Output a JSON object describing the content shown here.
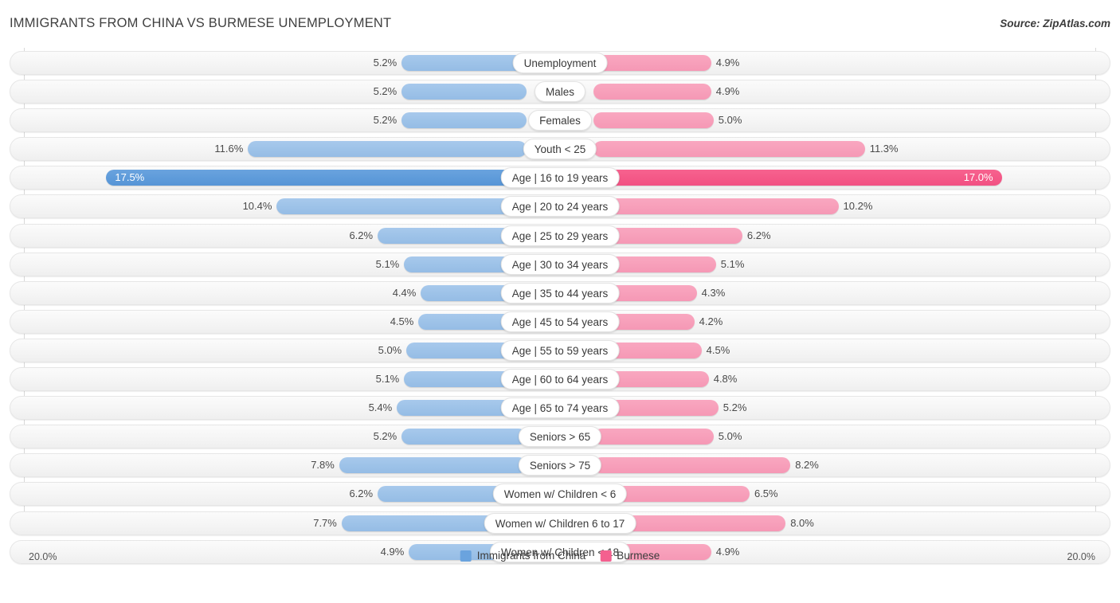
{
  "header": {
    "title": "IMMIGRANTS FROM CHINA VS BURMESE UNEMPLOYMENT",
    "source": "Source: ZipAtlas.com"
  },
  "legend": {
    "left": {
      "label": "Immigrants from China",
      "color": "#6aa3de"
    },
    "right": {
      "label": "Burmese",
      "color": "#f4608f"
    }
  },
  "axis": {
    "left_label": "20.0%",
    "right_label": "20.0%",
    "max": 20.0
  },
  "chart_data": {
    "type": "bar",
    "orientation": "horizontal-diverging",
    "title": "IMMIGRANTS FROM CHINA VS BURMESE UNEMPLOYMENT",
    "xlabel": "",
    "ylabel": "",
    "xlim": [
      0,
      20.0
    ],
    "grid": false,
    "legend_position": "bottom-center",
    "categories": [
      "Unemployment",
      "Males",
      "Females",
      "Youth < 25",
      "Age | 16 to 19 years",
      "Age | 20 to 24 years",
      "Age | 25 to 29 years",
      "Age | 30 to 34 years",
      "Age | 35 to 44 years",
      "Age | 45 to 54 years",
      "Age | 55 to 59 years",
      "Age | 60 to 64 years",
      "Age | 65 to 74 years",
      "Seniors > 65",
      "Seniors > 75",
      "Women w/ Children < 6",
      "Women w/ Children 6 to 17",
      "Women w/ Children < 18"
    ],
    "series": [
      {
        "name": "Immigrants from China",
        "values": [
          5.2,
          5.2,
          5.2,
          11.6,
          17.5,
          10.4,
          6.2,
          5.1,
          4.4,
          4.5,
          5.0,
          5.1,
          5.4,
          5.2,
          7.8,
          6.2,
          7.7,
          4.9
        ]
      },
      {
        "name": "Burmese",
        "values": [
          4.9,
          4.9,
          5.0,
          11.3,
          17.0,
          10.2,
          6.2,
          5.1,
          4.3,
          4.2,
          4.5,
          4.8,
          5.2,
          5.0,
          8.2,
          6.5,
          8.0,
          4.9
        ]
      }
    ]
  },
  "rows": [
    {
      "label": "Unemployment",
      "left": "5.2%",
      "right": "4.9%",
      "lv": 5.2,
      "rv": 4.9,
      "highlight": false
    },
    {
      "label": "Males",
      "left": "5.2%",
      "right": "4.9%",
      "lv": 5.2,
      "rv": 4.9,
      "highlight": false
    },
    {
      "label": "Females",
      "left": "5.2%",
      "right": "5.0%",
      "lv": 5.2,
      "rv": 5.0,
      "highlight": false
    },
    {
      "label": "Youth < 25",
      "left": "11.6%",
      "right": "11.3%",
      "lv": 11.6,
      "rv": 11.3,
      "highlight": false
    },
    {
      "label": "Age | 16 to 19 years",
      "left": "17.5%",
      "right": "17.0%",
      "lv": 17.5,
      "rv": 17.0,
      "highlight": true
    },
    {
      "label": "Age | 20 to 24 years",
      "left": "10.4%",
      "right": "10.2%",
      "lv": 10.4,
      "rv": 10.2,
      "highlight": false
    },
    {
      "label": "Age | 25 to 29 years",
      "left": "6.2%",
      "right": "6.2%",
      "lv": 6.2,
      "rv": 6.2,
      "highlight": false
    },
    {
      "label": "Age | 30 to 34 years",
      "left": "5.1%",
      "right": "5.1%",
      "lv": 5.1,
      "rv": 5.1,
      "highlight": false
    },
    {
      "label": "Age | 35 to 44 years",
      "left": "4.4%",
      "right": "4.3%",
      "lv": 4.4,
      "rv": 4.3,
      "highlight": false
    },
    {
      "label": "Age | 45 to 54 years",
      "left": "4.5%",
      "right": "4.2%",
      "lv": 4.5,
      "rv": 4.2,
      "highlight": false
    },
    {
      "label": "Age | 55 to 59 years",
      "left": "5.0%",
      "right": "4.5%",
      "lv": 5.0,
      "rv": 4.5,
      "highlight": false
    },
    {
      "label": "Age | 60 to 64 years",
      "left": "5.1%",
      "right": "4.8%",
      "lv": 5.1,
      "rv": 4.8,
      "highlight": false
    },
    {
      "label": "Age | 65 to 74 years",
      "left": "5.4%",
      "right": "5.2%",
      "lv": 5.4,
      "rv": 5.2,
      "highlight": false
    },
    {
      "label": "Seniors > 65",
      "left": "5.2%",
      "right": "5.0%",
      "lv": 5.2,
      "rv": 5.0,
      "highlight": false
    },
    {
      "label": "Seniors > 75",
      "left": "7.8%",
      "right": "8.2%",
      "lv": 7.8,
      "rv": 8.2,
      "highlight": false
    },
    {
      "label": "Women w/ Children < 6",
      "left": "6.2%",
      "right": "6.5%",
      "lv": 6.2,
      "rv": 6.5,
      "highlight": false
    },
    {
      "label": "Women w/ Children 6 to 17",
      "left": "7.7%",
      "right": "8.0%",
      "lv": 7.7,
      "rv": 8.0,
      "highlight": false
    },
    {
      "label": "Women w/ Children < 18",
      "left": "4.9%",
      "right": "4.9%",
      "lv": 4.9,
      "rv": 4.9,
      "highlight": false
    }
  ]
}
